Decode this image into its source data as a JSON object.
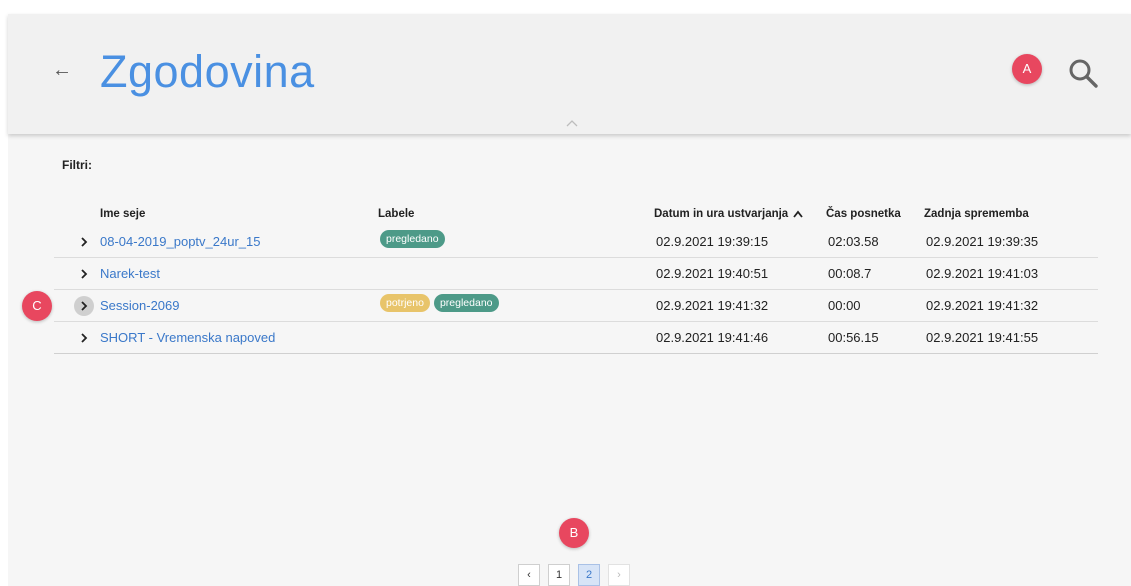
{
  "header": {
    "back_label": "←",
    "title": "Zgodovina"
  },
  "markers": {
    "a": "A",
    "b": "B",
    "c": "C"
  },
  "filters": {
    "label": "Filtri:"
  },
  "table": {
    "columns": {
      "name": "Ime seje",
      "labels": "Labele",
      "created": "Datum in ura ustvarjanja",
      "duration": "Čas posnetka",
      "modified": "Zadnja sprememba"
    },
    "rows": [
      {
        "name": "08-04-2019_poptv_24ur_15",
        "tags": [
          {
            "text": "pregledano",
            "color": "#4d9a88"
          }
        ],
        "created": "02.9.2021 19:39:15",
        "duration": "02:03.58",
        "modified": "02.9.2021 19:39:35"
      },
      {
        "name": "Narek-test",
        "tags": [],
        "created": "02.9.2021 19:40:51",
        "duration": "00:08.7",
        "modified": "02.9.2021 19:41:03"
      },
      {
        "name": "Session-2069",
        "tags": [
          {
            "text": "potrjeno",
            "color": "#e8c46a"
          },
          {
            "text": "pregledano",
            "color": "#4d9a88"
          }
        ],
        "created": "02.9.2021 19:41:32",
        "duration": "00:00",
        "modified": "02.9.2021 19:41:32"
      },
      {
        "name": "SHORT - Vremenska napoved",
        "tags": [],
        "created": "02.9.2021 19:41:46",
        "duration": "00:56.15",
        "modified": "02.9.2021 19:41:55"
      }
    ]
  },
  "pagination": {
    "prev": "‹",
    "pages": [
      "1",
      "2"
    ],
    "current": "2",
    "next": "›"
  },
  "colors": {
    "accent": "#4a90e2",
    "link": "#3a78c9",
    "marker": "#e8475f"
  }
}
